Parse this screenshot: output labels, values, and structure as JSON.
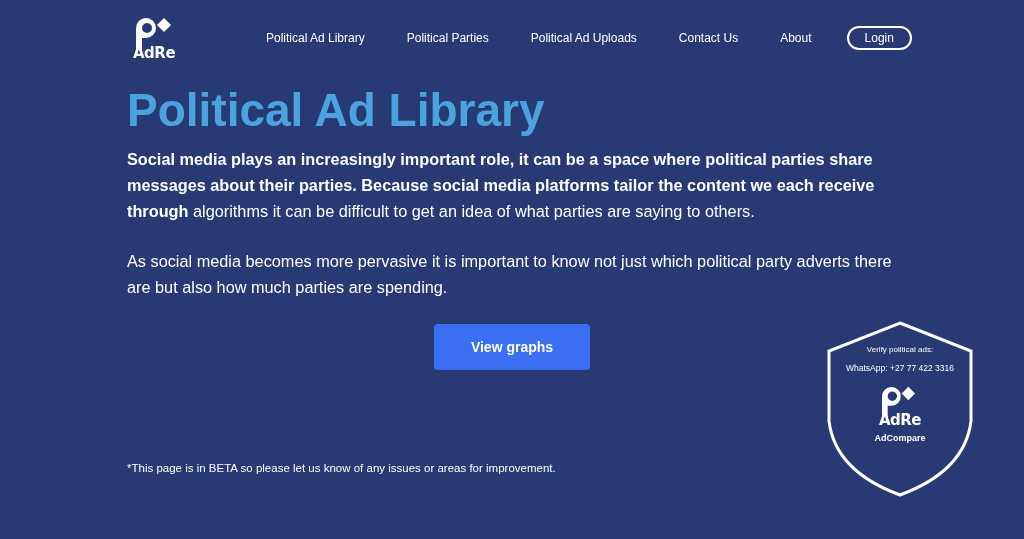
{
  "logo": {
    "text": "AdRe"
  },
  "nav": {
    "links": [
      "Political Ad Library",
      "Political Parties",
      "Political Ad Uploads",
      "Contact Us",
      "About"
    ],
    "login": "Login"
  },
  "title": "Political Ad Library",
  "paragraphs": [
    "**Social media plays an increasingly important role, it can be a space where political parties share messages about their parties. Because social media platforms tailor the content we each receive through** algorithms it can be difficult to get an idea of what parties are saying to others.",
    "As social media becomes more pervasive it is important to know not just which political party adverts there are but also how much parties are spending."
  ],
  "button": "View graphs",
  "note": "*This page is in BETA so please let us know of any issues or areas for improvement.",
  "badge": {
    "heading": "Verify political ads:",
    "whatsapp": "WhatsApp: +27 77 422 3316",
    "logo_text": "AdRe",
    "caption": "AdCompare"
  }
}
